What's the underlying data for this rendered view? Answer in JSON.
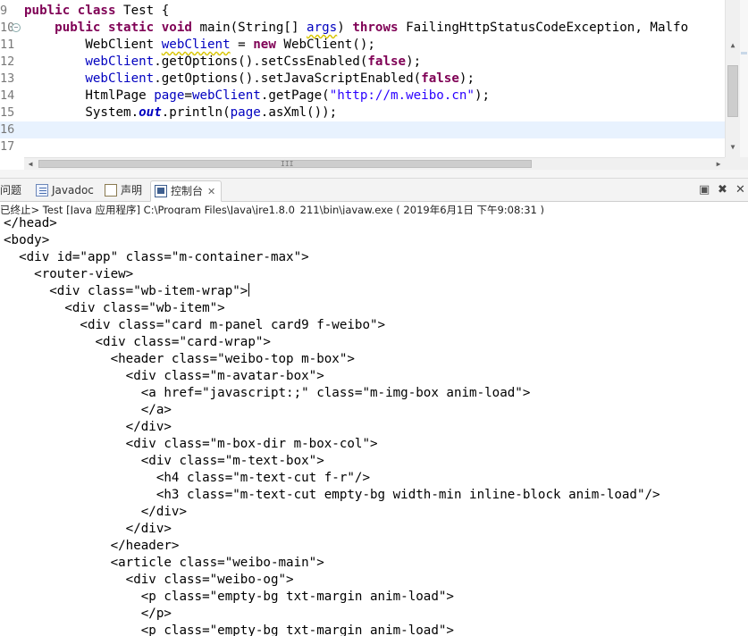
{
  "editor": {
    "lines": [
      {
        "num": "9",
        "tokens": [
          {
            "t": "public class",
            "c": "kw"
          },
          {
            "t": " Test {",
            "c": ""
          }
        ]
      },
      {
        "num": "10",
        "fold": true,
        "tokens": [
          {
            "t": "    ",
            "c": ""
          },
          {
            "t": "public static void",
            "c": "kw"
          },
          {
            "t": " main(String[] ",
            "c": ""
          },
          {
            "t": "args",
            "c": "warnvar"
          },
          {
            "t": ") ",
            "c": ""
          },
          {
            "t": "throws",
            "c": "kw"
          },
          {
            "t": " FailingHttpStatusCodeException, Malfo",
            "c": ""
          }
        ]
      },
      {
        "num": "11",
        "tokens": [
          {
            "t": "        WebClient ",
            "c": ""
          },
          {
            "t": "webClient",
            "c": "warnvar"
          },
          {
            "t": " = ",
            "c": ""
          },
          {
            "t": "new",
            "c": "kw"
          },
          {
            "t": " WebClient();",
            "c": ""
          }
        ]
      },
      {
        "num": "12",
        "tokens": [
          {
            "t": "        ",
            "c": ""
          },
          {
            "t": "webClient",
            "c": "var"
          },
          {
            "t": ".getOptions().setCssEnabled(",
            "c": ""
          },
          {
            "t": "false",
            "c": "kw"
          },
          {
            "t": ");",
            "c": ""
          }
        ]
      },
      {
        "num": "13",
        "tokens": [
          {
            "t": "        ",
            "c": ""
          },
          {
            "t": "webClient",
            "c": "var"
          },
          {
            "t": ".getOptions().setJavaScriptEnabled(",
            "c": ""
          },
          {
            "t": "false",
            "c": "kw"
          },
          {
            "t": ");",
            "c": ""
          }
        ]
      },
      {
        "num": "14",
        "tokens": [
          {
            "t": "        HtmlPage ",
            "c": ""
          },
          {
            "t": "page",
            "c": "var"
          },
          {
            "t": "=",
            "c": ""
          },
          {
            "t": "webClient",
            "c": "var"
          },
          {
            "t": ".getPage(",
            "c": ""
          },
          {
            "t": "\"http://m.weibo.cn\"",
            "c": "str"
          },
          {
            "t": ");",
            "c": ""
          }
        ]
      },
      {
        "num": "15",
        "tokens": [
          {
            "t": "        System.",
            "c": ""
          },
          {
            "t": "out",
            "c": "stat"
          },
          {
            "t": ".println(",
            "c": ""
          },
          {
            "t": "page",
            "c": "var"
          },
          {
            "t": ".asXml());",
            "c": ""
          }
        ]
      },
      {
        "num": "16",
        "current": true,
        "tokens": []
      },
      {
        "num": "17",
        "tokens": []
      }
    ],
    "scroll_grip": "III"
  },
  "views": {
    "tabs": [
      {
        "label": "问题",
        "icon": "problems-icon"
      },
      {
        "label": "Javadoc",
        "icon": "javadoc-icon"
      },
      {
        "label": "声明",
        "icon": "declaration-icon"
      },
      {
        "label": "控制台",
        "icon": "console-icon",
        "active": true,
        "close": "✕"
      }
    ],
    "toolbar": {
      "minimize": "▣",
      "remove": "✖",
      "terminate": "✕"
    }
  },
  "console": {
    "header": "已终止> Test [Java 应用程序] C:\\Program Files\\Java\\jre1.8.0_211\\bin\\javaw.exe ( 2019年6月1日 下午9:08:31 )",
    "lines": [
      "</head>",
      "<body>",
      "  <div id=\"app\" class=\"m-container-max\">",
      "    <router-view>",
      "      <div class=\"wb-item-wrap\">",
      "        <div class=\"wb-item\">",
      "          <div class=\"card m-panel card9 f-weibo\">",
      "            <div class=\"card-wrap\">",
      "              <header class=\"weibo-top m-box\">",
      "                <div class=\"m-avatar-box\">",
      "                  <a href=\"javascript:;\" class=\"m-img-box anim-load\">",
      "                  </a>",
      "                </div>",
      "                <div class=\"m-box-dir m-box-col\">",
      "                  <div class=\"m-text-box\">",
      "                    <h4 class=\"m-text-cut f-r\"/>",
      "                    <h3 class=\"m-text-cut empty-bg width-min inline-block anim-load\"/>",
      "                  </div>",
      "                </div>",
      "              </header>",
      "              <article class=\"weibo-main\">",
      "                <div class=\"weibo-og\">",
      "                  <p class=\"empty-bg txt-margin anim-load\">",
      "                  </p>",
      "                  <p class=\"empty-bg txt-margin anim-load\">"
    ],
    "caret_line": 4
  }
}
